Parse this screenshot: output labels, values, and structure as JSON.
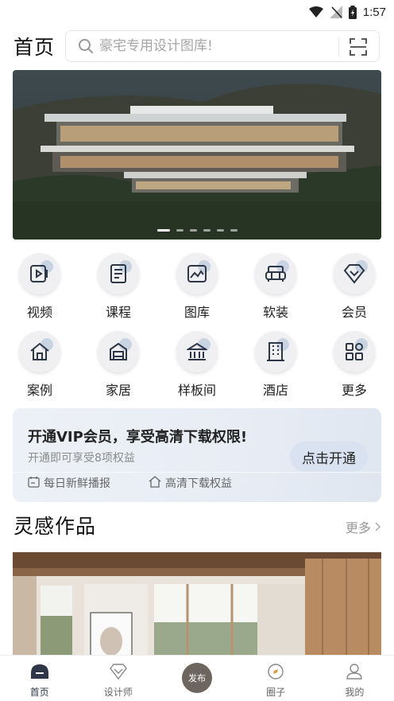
{
  "status_bar": {
    "time": "1:57"
  },
  "header": {
    "title": "首页",
    "search_placeholder": "豪宅专用设计图库!"
  },
  "banner": {
    "dot_count": 6,
    "active_index": 0
  },
  "categories_row1": [
    {
      "label": "视频",
      "icon": "video-icon"
    },
    {
      "label": "课程",
      "icon": "course-icon"
    },
    {
      "label": "图库",
      "icon": "gallery-icon"
    },
    {
      "label": "软装",
      "icon": "sofa-icon"
    },
    {
      "label": "会员",
      "icon": "diamond-icon"
    }
  ],
  "categories_row2": [
    {
      "label": "案例",
      "icon": "house-icon"
    },
    {
      "label": "家居",
      "icon": "home-icon"
    },
    {
      "label": "样板间",
      "icon": "showroom-icon"
    },
    {
      "label": "酒店",
      "icon": "hotel-icon"
    },
    {
      "label": "更多",
      "icon": "more-icon"
    }
  ],
  "vip": {
    "title": "开通VIP会员，享受高清下载权限!",
    "subtitle": "开通即可享受8项权益",
    "button": "点击开通",
    "feature1": "每日新鲜播报",
    "feature2": "高清下载权益"
  },
  "inspiration": {
    "title": "灵感作品",
    "more": "更多"
  },
  "tabbar": {
    "home": "首页",
    "designer": "设计师",
    "post": "发布",
    "circle": "圈子",
    "mine": "我的"
  },
  "colors": {
    "accent": "#2e3748",
    "vip_button": "#d8e2f0"
  }
}
